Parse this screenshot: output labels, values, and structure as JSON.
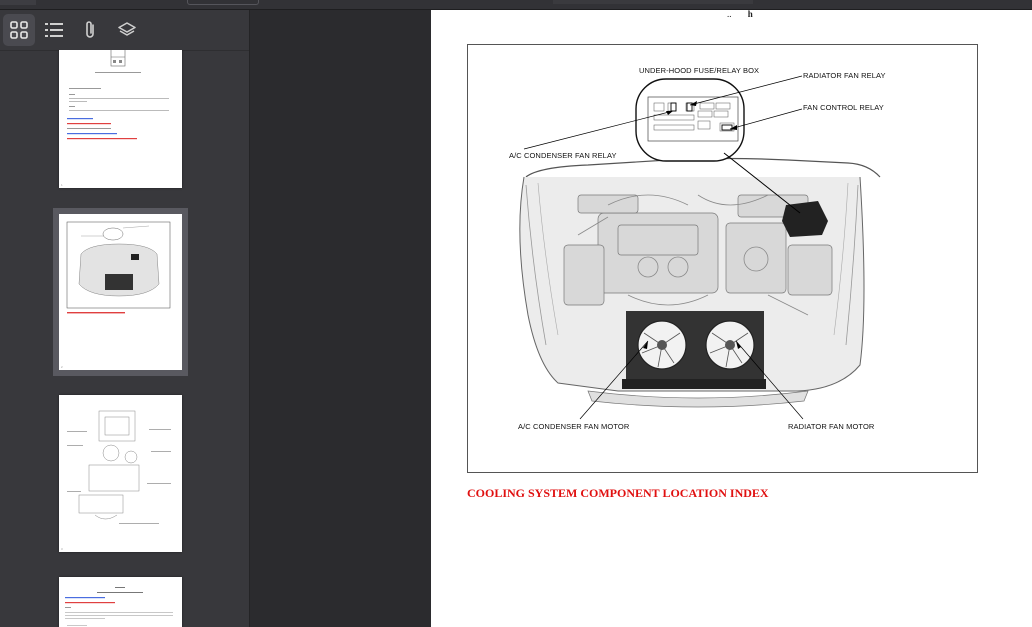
{
  "sidebar": {
    "toolbar": {
      "thumbnails_icon": "grid-icon",
      "outline_icon": "list-icon",
      "attachments_icon": "paperclip-icon",
      "layers_icon": "layers-icon"
    },
    "thumbnails": [
      {
        "page": "1"
      },
      {
        "page": "2",
        "selected": true
      },
      {
        "page": "3"
      },
      {
        "page": "4"
      }
    ]
  },
  "page": {
    "header_dots": "..",
    "header_h": "h",
    "callouts": {
      "fuse_box": "UNDER-HOOD FUSE/RELAY BOX",
      "radiator_fan_relay": "RADIATOR FAN RELAY",
      "fan_control_relay": "FAN CONTROL RELAY",
      "ac_condenser_fan_relay": "A/C CONDENSER FAN RELAY",
      "ac_condenser_fan_motor": "A/C CONDENSER FAN MOTOR",
      "radiator_fan_motor": "RADIATOR FAN MOTOR"
    },
    "link": "COOLING SYSTEM COMPONENT LOCATION INDEX",
    "link_color": "#e01010"
  }
}
